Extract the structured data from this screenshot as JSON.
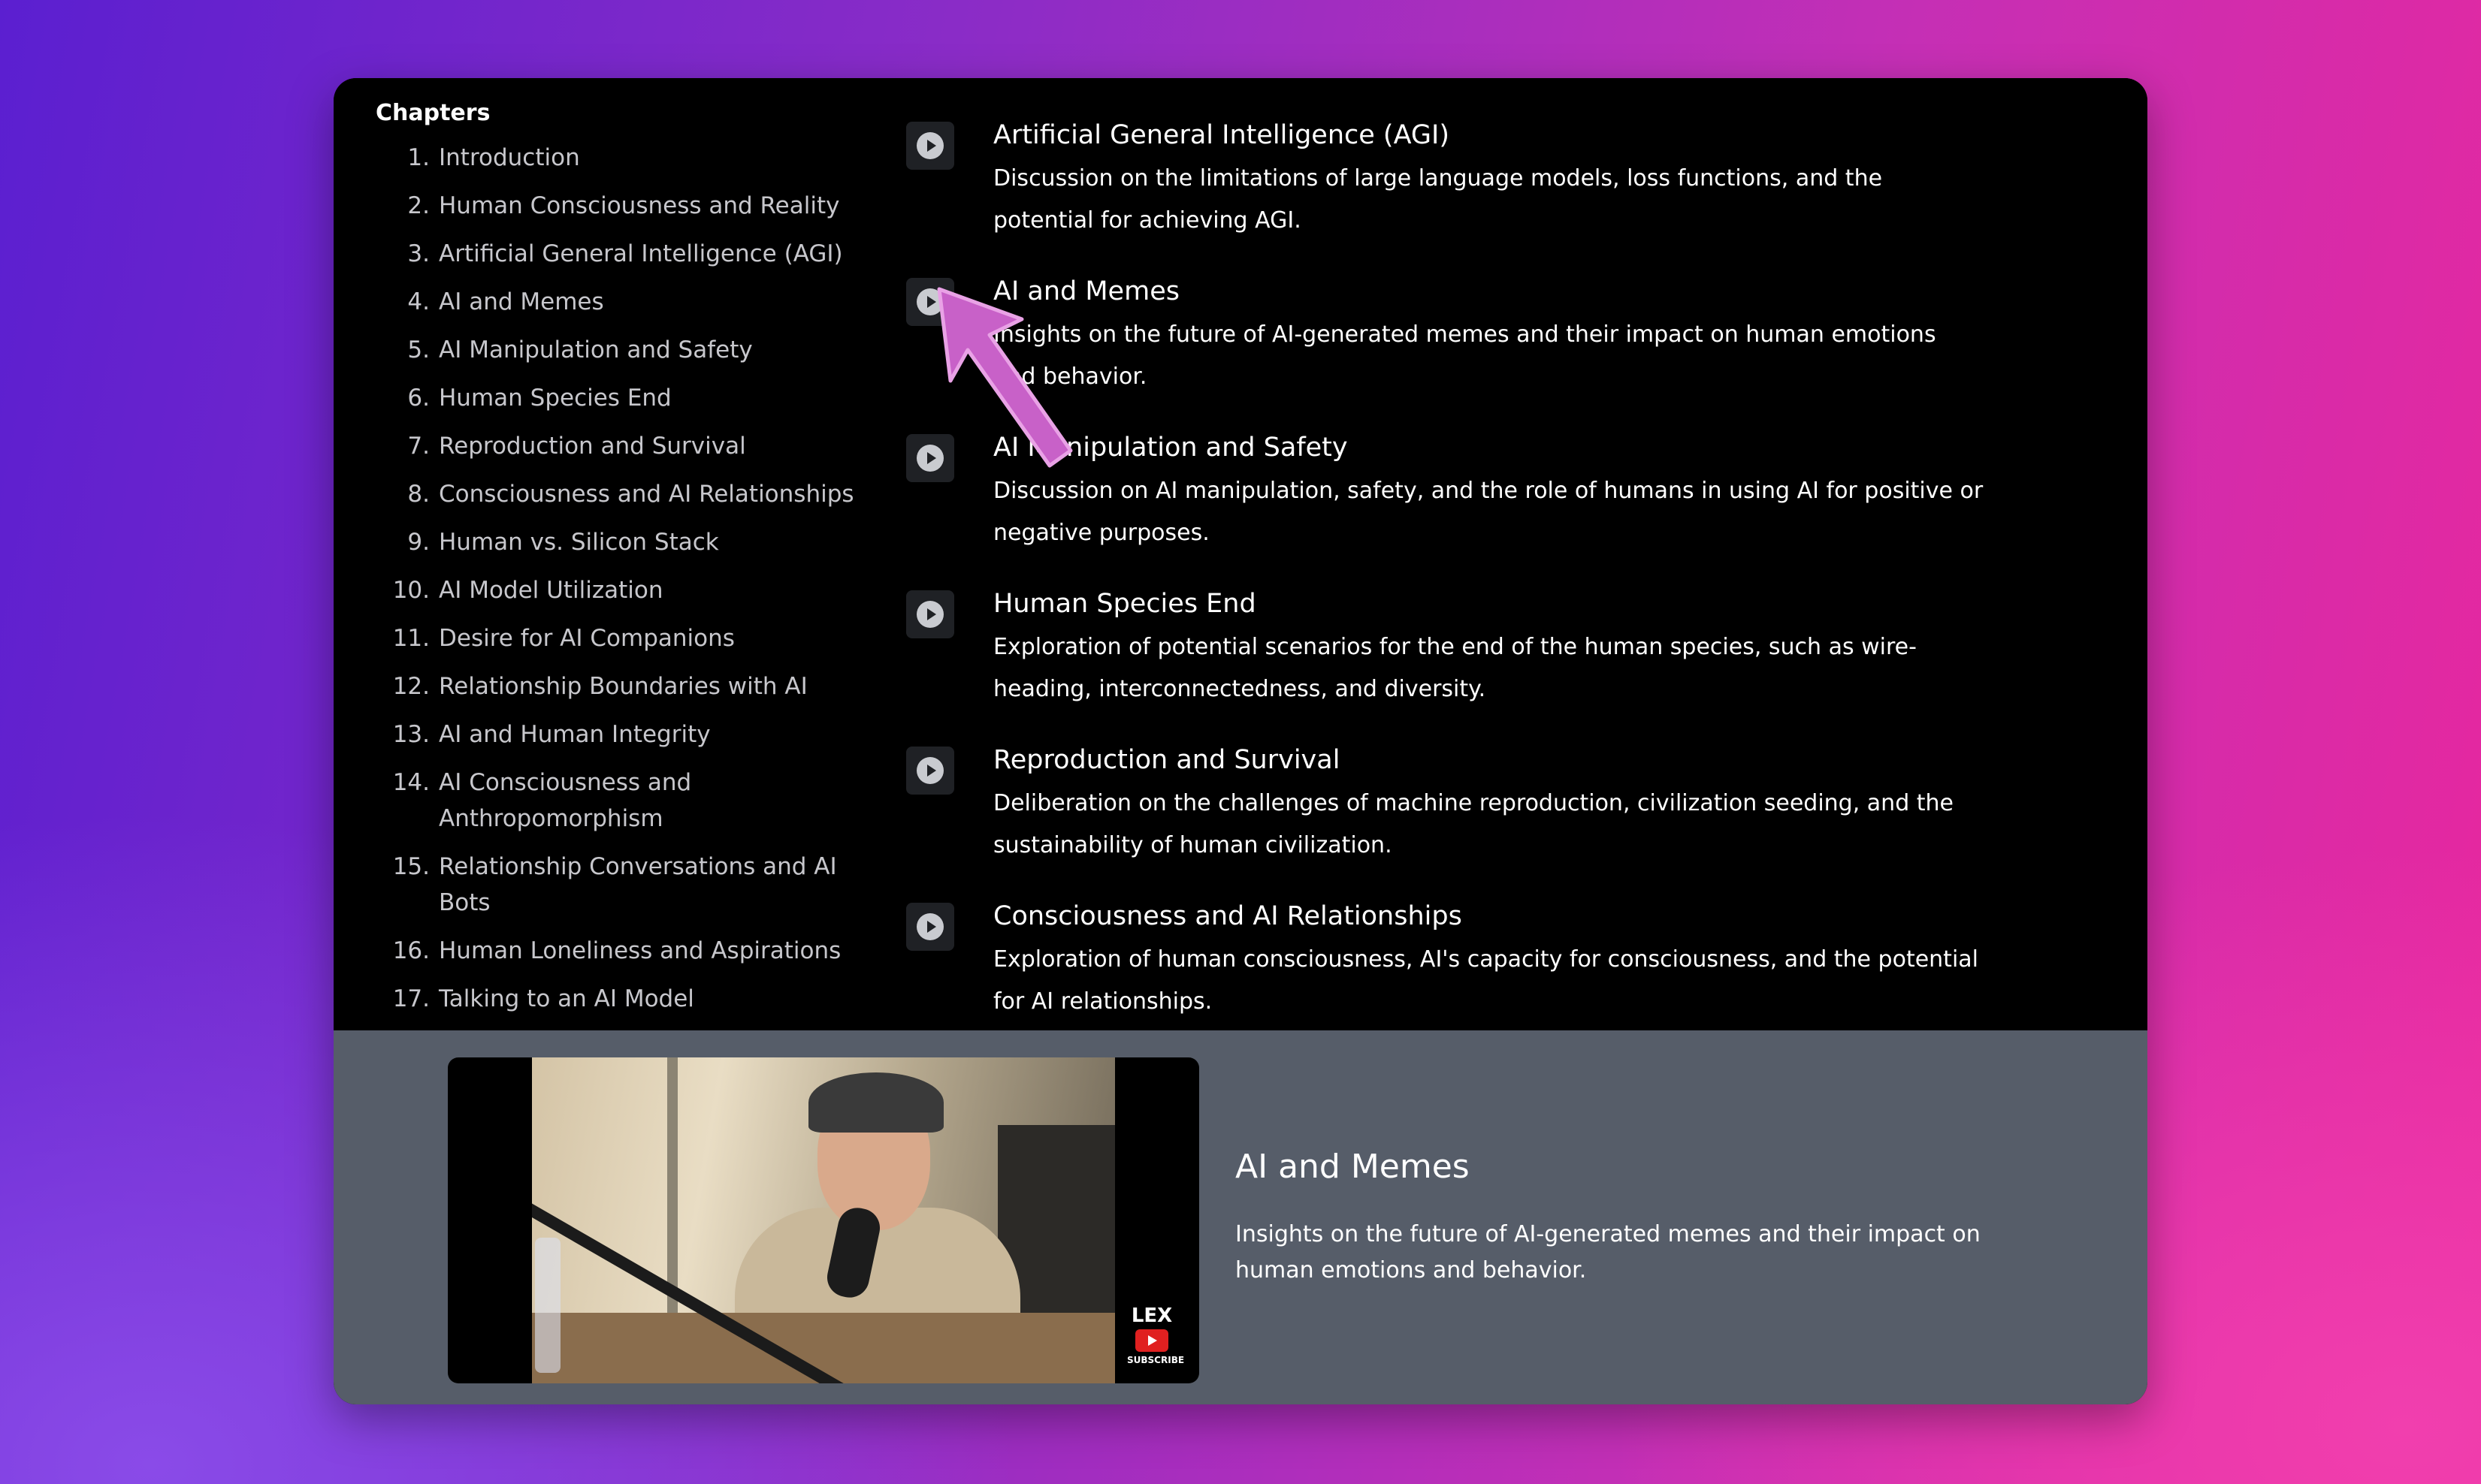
{
  "sidebar": {
    "title": "Chapters",
    "chapters": [
      {
        "num": "1.",
        "label": "Introduction"
      },
      {
        "num": "2.",
        "label": "Human Consciousness and Reality"
      },
      {
        "num": "3.",
        "label": "Artificial General Intelligence (AGI)"
      },
      {
        "num": "4.",
        "label": "AI and Memes"
      },
      {
        "num": "5.",
        "label": "AI Manipulation and Safety"
      },
      {
        "num": "6.",
        "label": "Human Species End"
      },
      {
        "num": "7.",
        "label": "Reproduction and Survival"
      },
      {
        "num": "8.",
        "label": "Consciousness and AI Relationships"
      },
      {
        "num": "9.",
        "label": "Human vs. Silicon Stack"
      },
      {
        "num": "10.",
        "label": "AI Model Utilization"
      },
      {
        "num": "11.",
        "label": "Desire for AI Companions"
      },
      {
        "num": "12.",
        "label": "Relationship Boundaries with AI"
      },
      {
        "num": "13.",
        "label": "AI and Human Integrity"
      },
      {
        "num": "14.",
        "label": "AI Consciousness and Anthropomorphism"
      },
      {
        "num": "15.",
        "label": "Relationship Conversations and AI Bots"
      },
      {
        "num": "16.",
        "label": "Human Loneliness and Aspirations"
      },
      {
        "num": "17.",
        "label": "Talking to an AI Model"
      }
    ]
  },
  "entries": [
    {
      "title": "Artificial General Intelligence (AGI)",
      "description": "Discussion on the limitations of large language models, loss functions, and the potential for achieving AGI."
    },
    {
      "title": "AI and Memes",
      "description": "Insights on the future of AI-generated memes and their impact on human emotions and behavior."
    },
    {
      "title": "AI Manipulation and Safety",
      "description": "Discussion on AI manipulation, safety, and the role of humans in using AI for positive or negative purposes."
    },
    {
      "title": "Human Species End",
      "description": "Exploration of potential scenarios for the end of the human species, such as wire-heading, interconnectedness, and diversity."
    },
    {
      "title": "Reproduction and Survival",
      "description": "Deliberation on the challenges of machine reproduction, civilization seeding, and the sustainability of human civilization."
    },
    {
      "title": "Consciousness and AI Relationships",
      "description": "Exploration of human consciousness, AI's capacity for consciousness, and the potential for AI relationships."
    }
  ],
  "now_playing": {
    "title": "AI and Memes",
    "description": "Insights on the future of AI-generated memes and their impact on human emotions and behavior.",
    "watermark": {
      "name": "LEX",
      "subscribe": "SUBSCRIBE"
    }
  },
  "icons": {
    "play": "play-icon",
    "cursor": "arrow-cursor-icon",
    "youtube": "youtube-icon"
  },
  "colors": {
    "accent_arrow": "#c861c8",
    "panel": "#565d69",
    "background_left": "#5b1fd0",
    "background_right": "#e9279d"
  }
}
